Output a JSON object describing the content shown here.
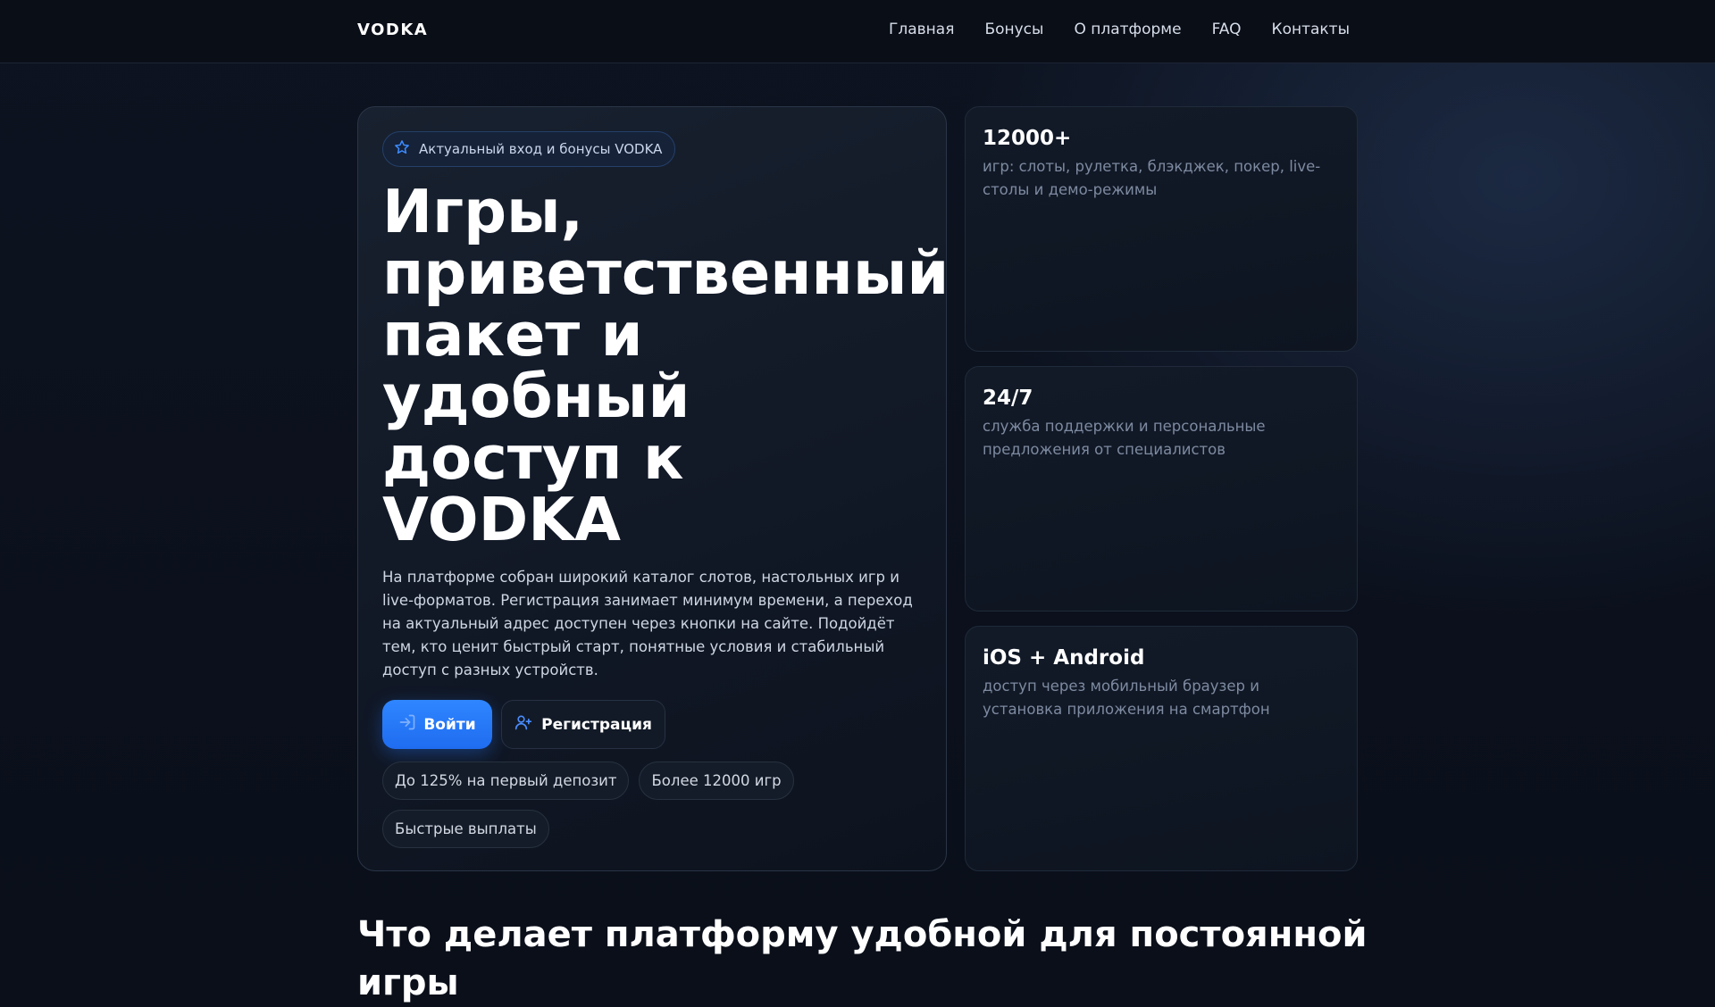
{
  "header": {
    "brand": "VODKA",
    "nav": [
      "Главная",
      "Бонусы",
      "О платформе",
      "FAQ",
      "Контакты"
    ]
  },
  "hero": {
    "badge": "Актуальный вход и бонусы VODKA",
    "title_lines": [
      "Игры,",
      "приветственный",
      "пакет и",
      "удобный",
      "доступ к",
      "VODKA"
    ],
    "description": "На платформе собран широкий каталог слотов, настольных игр и live-форматов. Регистрация занимает минимум времени, а переход на актуальный адрес доступен через кнопки на сайте. Подойдёт тем, кто ценит быстрый старт, понятные условия и стабильный доступ с разных устройств.",
    "login_label": "Войти",
    "register_label": "Регистрация",
    "tags": [
      "До 125% на первый депозит",
      "Более 12000 игр",
      "Быстрые выплаты"
    ]
  },
  "stats": [
    {
      "value": "12000+",
      "text": "игр: слоты, рулетка, блэкджек, покер, live-столы и демо-режимы"
    },
    {
      "value": "24/7",
      "text": "служба поддержки и персональные предложения от специалистов"
    },
    {
      "value": "iOS + Android",
      "text": "доступ через мобильный браузер и установка приложения на смартфон"
    }
  ],
  "section": {
    "title": "Что делает платформу удобной для постоянной игры"
  },
  "colors": {
    "accent": "#2f86ff",
    "background": "#0a0f1a"
  },
  "icons": {
    "badge": "star-icon",
    "login": "login-arrow-icon",
    "register": "user-plus-icon"
  }
}
